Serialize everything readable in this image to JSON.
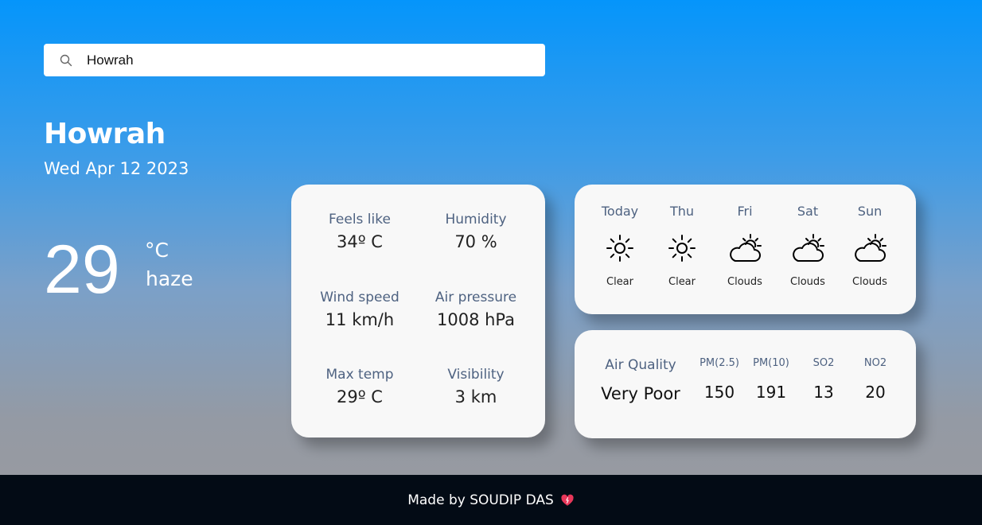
{
  "search": {
    "value": "Howrah",
    "placeholder": ""
  },
  "location": {
    "city": "Howrah",
    "date": "Wed Apr 12 2023"
  },
  "current": {
    "temperature": "29",
    "unit": "°C",
    "condition": "haze"
  },
  "details": [
    {
      "label": "Feels like",
      "value": "34º C"
    },
    {
      "label": "Humidity",
      "value": "70 %"
    },
    {
      "label": "Wind speed",
      "value": "11 km/h"
    },
    {
      "label": "Air pressure",
      "value": "1008 hPa"
    },
    {
      "label": "Max temp",
      "value": "29º C"
    },
    {
      "label": "Visibility",
      "value": "3 km"
    }
  ],
  "forecast": [
    {
      "day": "Today",
      "icon": "sun-icon",
      "desc": "Clear"
    },
    {
      "day": "Thu",
      "icon": "sun-icon",
      "desc": "Clear"
    },
    {
      "day": "Fri",
      "icon": "cloud-sun-icon",
      "desc": "Clouds"
    },
    {
      "day": "Sat",
      "icon": "cloud-sun-icon",
      "desc": "Clouds"
    },
    {
      "day": "Sun",
      "icon": "cloud-sun-icon",
      "desc": "Clouds"
    }
  ],
  "air_quality": {
    "label": "Air Quality",
    "value": "Very Poor",
    "pollutants": [
      {
        "label": "PM(2.5)",
        "value": "150"
      },
      {
        "label": "PM(10)",
        "value": "191"
      },
      {
        "label": "SO2",
        "value": "13"
      },
      {
        "label": "NO2",
        "value": "20"
      }
    ]
  },
  "footer": {
    "text": "Made by SOUDIP DAS"
  },
  "colors": {
    "label": "#4e6281",
    "footer_bg": "#030b15",
    "heart": "#e8375a"
  }
}
